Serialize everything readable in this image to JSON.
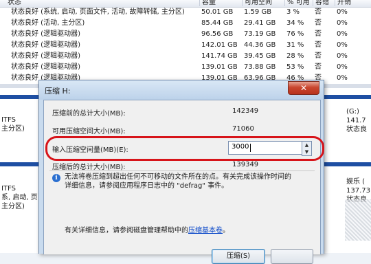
{
  "volume_table": {
    "columns": [
      "状态",
      "容量",
      "可用空间",
      "% 可用",
      "容错",
      "开销"
    ],
    "rows": [
      [
        "状态良好 (系统, 启动, 页面文件, 活动, 故障转储, 主分区)",
        "50.01 GB",
        "1.59 GB",
        "3 %",
        "否",
        "0%"
      ],
      [
        "状态良好 (活动, 主分区)",
        "85.44 GB",
        "29.41 GB",
        "34 %",
        "否",
        "0%"
      ],
      [
        "状态良好 (逻辑驱动器)",
        "96.56 GB",
        "73.19 GB",
        "76 %",
        "否",
        "0%"
      ],
      [
        "状态良好 (逻辑驱动器)",
        "142.01 GB",
        "44.36 GB",
        "31 %",
        "否",
        "0%"
      ],
      [
        "状态良好 (逻辑驱动器)",
        "141.74 GB",
        "39.45 GB",
        "28 %",
        "否",
        "0%"
      ],
      [
        "状态良好 (逻辑驱动器)",
        "139.01 GB",
        "73.88 GB",
        "53 %",
        "否",
        "0%"
      ],
      [
        "状态良好 (逻辑驱动器)",
        "139.01 GB",
        "63.96 GB",
        "46 %",
        "否",
        "0%"
      ]
    ]
  },
  "disk_panel": {
    "left_1": [
      "ITFS",
      "主分区)"
    ],
    "left_2": [
      "ITFS",
      "系, 启动, 页",
      "主分区)"
    ],
    "right_1": [
      "(G:)",
      "141.7",
      "状态良"
    ],
    "right_2": [
      "娱乐 (",
      "137.73",
      "状态良"
    ]
  },
  "dialog": {
    "title": "压缩 H:",
    "close_symbol": "✕",
    "fields": [
      {
        "label": "压缩前的总计大小(MB):",
        "value": "142349"
      },
      {
        "label": "可用压缩空间大小(MB):",
        "value": "71060"
      },
      {
        "label": "输入压缩空间量(MB)(E):",
        "value": "3000"
      },
      {
        "label": "压缩后的总计大小(MB):",
        "value": "139349"
      }
    ],
    "note_lines": [
      "无法将卷压缩到超出任何不可移动的文件所在的点。有关完成该操作时间的",
      "详细信息，请参阅应用程序日志中的 \"defrag\" 事件。"
    ],
    "help_prefix": "有关详细信息，请参阅磁盘管理帮助中的",
    "help_link": "压缩基本卷",
    "help_suffix": "。",
    "compress_label": "压缩(S)",
    "spin_up": "▲",
    "spin_down": "▼",
    "info_symbol": "i"
  },
  "colors": {
    "highlight": "#d7141a",
    "disk_band": "#1e4fa3",
    "link": "#0645c8"
  }
}
